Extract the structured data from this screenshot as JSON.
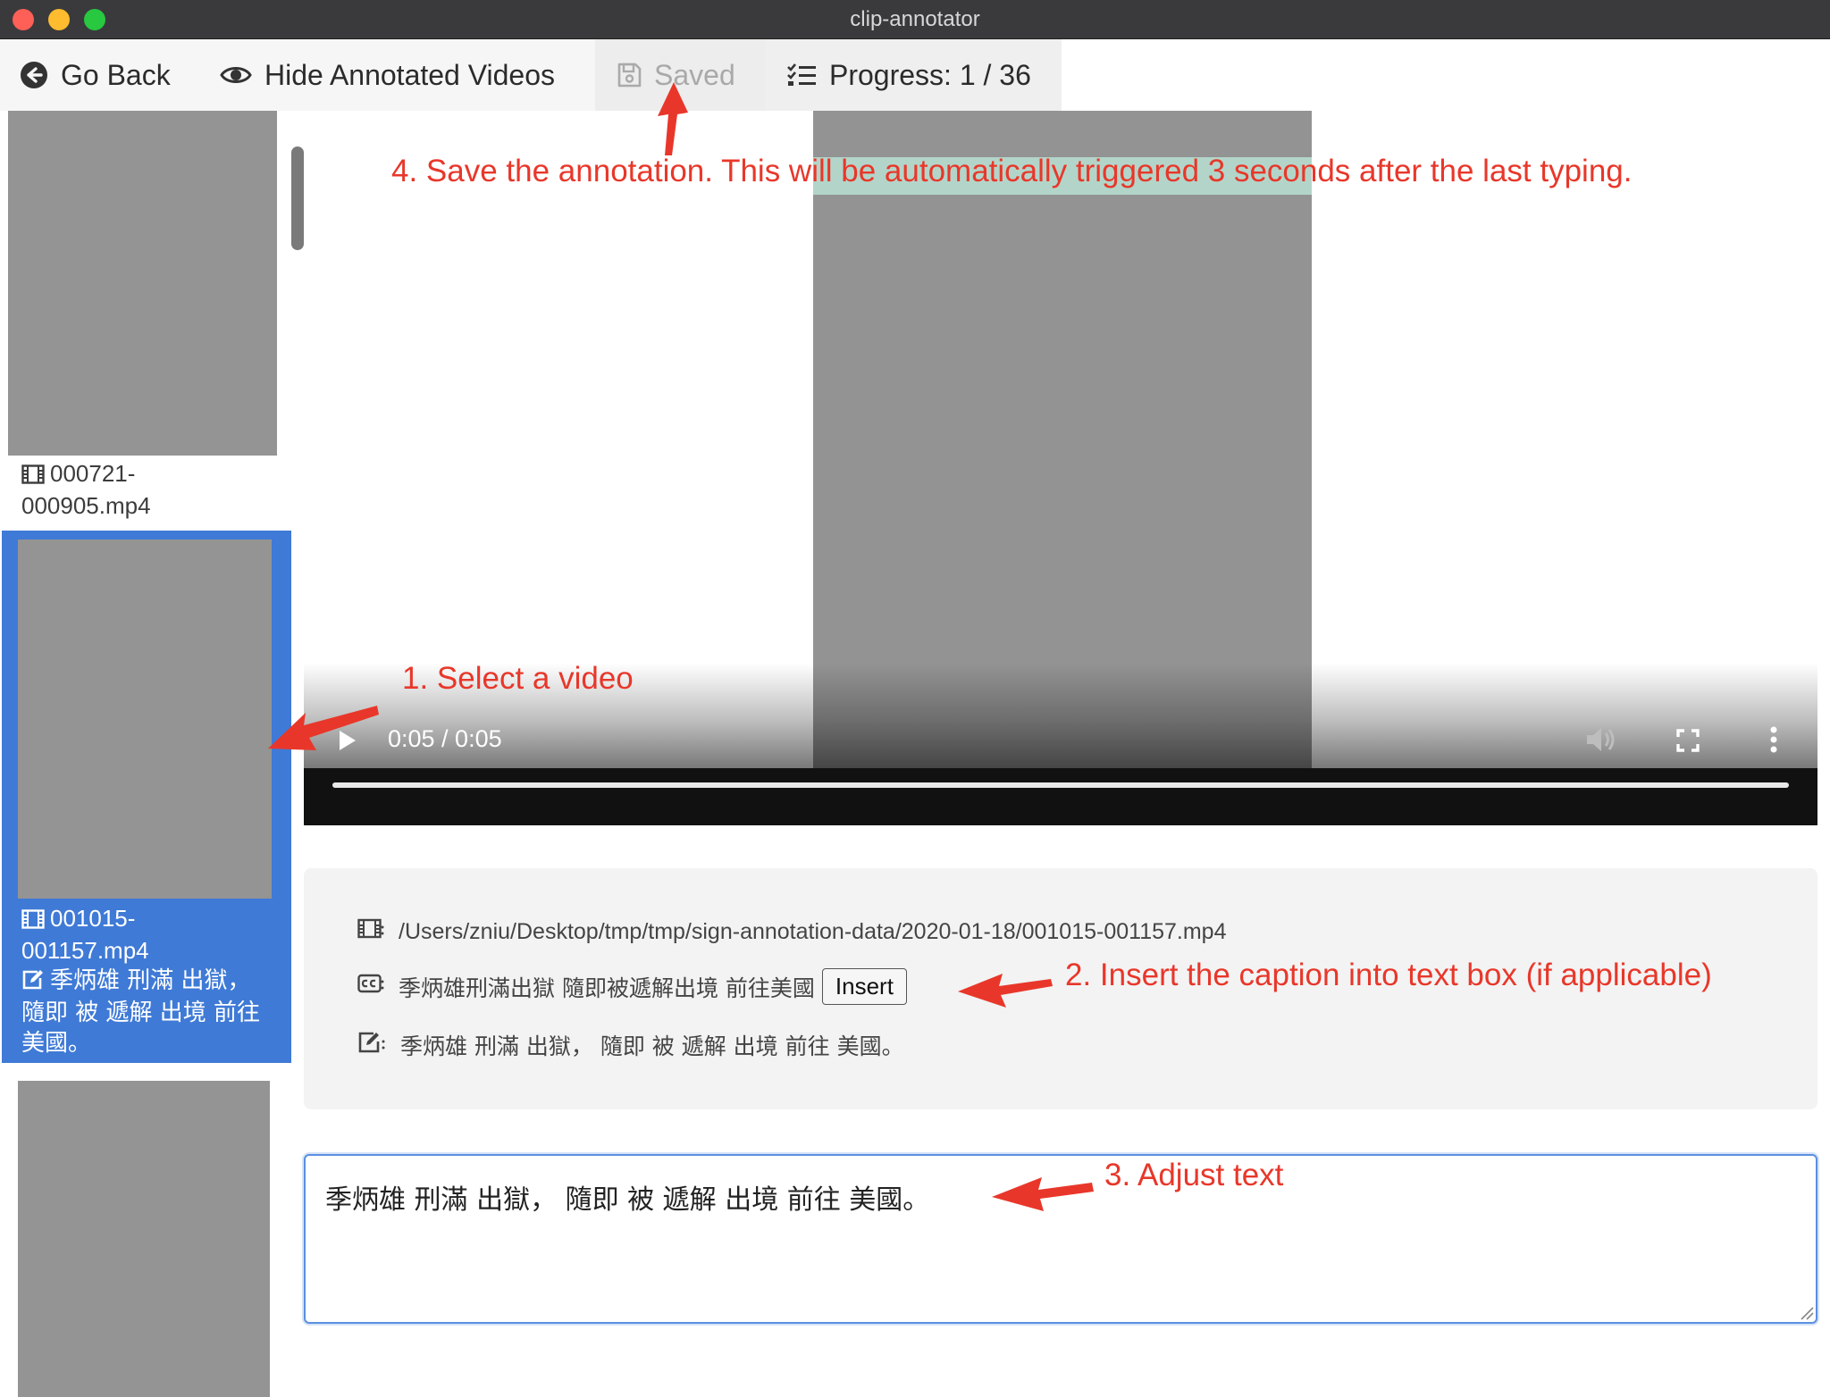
{
  "window": {
    "title": "clip-annotator"
  },
  "toolbar": {
    "go_back": "Go Back",
    "hide_annotated": "Hide Annotated Videos",
    "saved": "Saved",
    "progress": "Progress: 1 / 36"
  },
  "sidebar": {
    "items": [
      {
        "filename_line1": "000721-",
        "filename_line2": "000905.mp4"
      },
      {
        "filename_line1": "001015-",
        "filename_line2": "001157.mp4",
        "caption_line1": "季炳雄 刑滿 出獄，",
        "caption_line2": "隨即 被 遞解 出境 前往",
        "caption_line3": "美國。",
        "selected": true
      }
    ]
  },
  "player": {
    "time": "0:05 / 0:05",
    "progress_fraction": 1.0
  },
  "info": {
    "path": "/Users/zniu/Desktop/tmp/tmp/sign-annotation-data/2020-01-18/001015-001157.mp4",
    "caption": "季炳雄刑滿出獄 隨即被遞解出境 前往美國",
    "insert_label": "Insert",
    "annotation": "季炳雄 刑滿 出獄， 隨即 被 遞解 出境 前往 美國。"
  },
  "editor": {
    "value": "季炳雄 刑滿 出獄， 隨即 被 遞解 出境 前往 美國。"
  },
  "annotations": {
    "step1": "1. Select a video",
    "step2": "2. Insert the caption into text box (if applicable)",
    "step3": "3. Adjust text",
    "step4": "4. Save the annotation. This will be automatically triggered 3 seconds after the last typing."
  },
  "colors": {
    "annotation": "#e8372a",
    "selected": "#3f7ad6",
    "thumbnail": "#949494"
  }
}
